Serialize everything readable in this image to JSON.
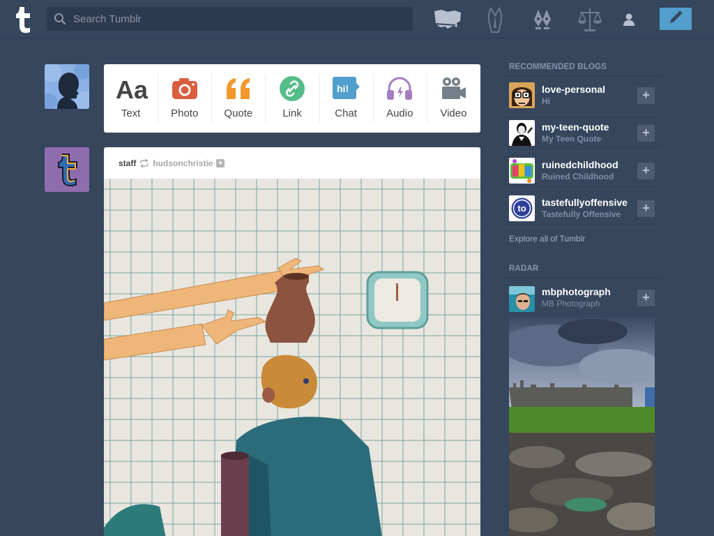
{
  "header": {
    "search_placeholder": "Search Tumblr",
    "nav_icons": [
      "explore-map-icon",
      "activity-icon",
      "pen-nib-icon",
      "balance-scale-icon",
      "account-icon"
    ],
    "compose_icon": "pencil-icon"
  },
  "post_types": [
    {
      "label": "Text",
      "icon": "text-aa-icon",
      "color": "#444444"
    },
    {
      "label": "Photo",
      "icon": "camera-icon",
      "color": "#d95e40"
    },
    {
      "label": "Quote",
      "icon": "quote-icon",
      "color": "#f2992e"
    },
    {
      "label": "Link",
      "icon": "link-icon",
      "color": "#56bc8a"
    },
    {
      "label": "Chat",
      "icon": "chat-icon",
      "color": "#529ecc"
    },
    {
      "label": "Audio",
      "icon": "headphones-icon",
      "color": "#a77dc2"
    },
    {
      "label": "Video",
      "icon": "video-camera-icon",
      "color": "#748089"
    }
  ],
  "post": {
    "user": "staff",
    "source": "hudsonchristie",
    "follow_glyph": "+"
  },
  "sidebar": {
    "recommended_heading": "RECOMMENDED BLOGS",
    "recommended": [
      {
        "name": "love-personal",
        "title": "Hi"
      },
      {
        "name": "my-teen-quote",
        "title": "My Teen Quote"
      },
      {
        "name": "ruinedchildhood",
        "title": "Ruined Childhood"
      },
      {
        "name": "tastefullyoffensive",
        "title": "Tastefully Offensive"
      }
    ],
    "follow_glyph": "+",
    "explore_link": "Explore all of Tumblr",
    "radar_heading": "RADAR",
    "radar": {
      "name": "mbphotograph",
      "title": "MB Photograph"
    },
    "to_logo_text": "to",
    "chat_icon_text": "hi!"
  },
  "colors": {
    "background": "#36465d",
    "accent": "#529ecc"
  }
}
